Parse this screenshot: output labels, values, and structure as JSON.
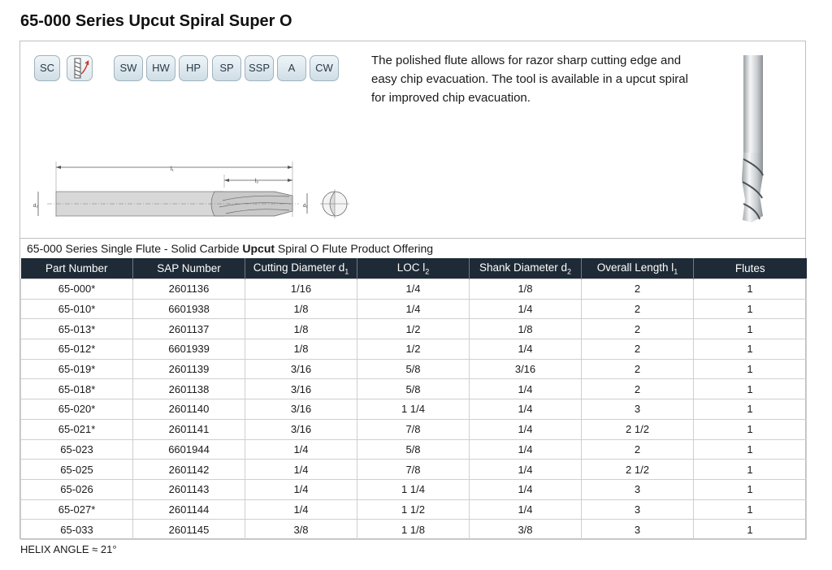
{
  "title": "65-000 Series Upcut Spiral Super O",
  "badges": [
    "SC",
    "SW",
    "HW",
    "HP",
    "SP",
    "SSP",
    "A",
    "CW"
  ],
  "description": "The polished flute allows for razor sharp cutting edge and easy chip evacuation. The tool is available in a upcut spiral for improved chip evacuation.",
  "drawing_labels": {
    "l1": "l₁",
    "l2": "l₂",
    "d1": "d₁",
    "d2": "d₂"
  },
  "offering": {
    "prefix": "65-000 Series Single Flute - Solid Carbide ",
    "bold": "Upcut",
    "suffix": " Spiral O Flute Product Offering"
  },
  "table": {
    "headers": [
      {
        "text": "Part Number",
        "sub": ""
      },
      {
        "text": "SAP Number",
        "sub": ""
      },
      {
        "text": "Cutting Diameter d",
        "sub": "1"
      },
      {
        "text": "LOC l",
        "sub": "2"
      },
      {
        "text": "Shank Diameter d",
        "sub": "2"
      },
      {
        "text": "Overall Length l",
        "sub": "1"
      },
      {
        "text": "Flutes",
        "sub": ""
      }
    ],
    "rows": [
      [
        "65-000*",
        "2601136",
        "1/16",
        "1/4",
        "1/8",
        "2",
        "1"
      ],
      [
        "65-010*",
        "6601938",
        "1/8",
        "1/4",
        "1/4",
        "2",
        "1"
      ],
      [
        "65-013*",
        "2601137",
        "1/8",
        "1/2",
        "1/8",
        "2",
        "1"
      ],
      [
        "65-012*",
        "6601939",
        "1/8",
        "1/2",
        "1/4",
        "2",
        "1"
      ],
      [
        "65-019*",
        "2601139",
        "3/16",
        "5/8",
        "3/16",
        "2",
        "1"
      ],
      [
        "65-018*",
        "2601138",
        "3/16",
        "5/8",
        "1/4",
        "2",
        "1"
      ],
      [
        "65-020*",
        "2601140",
        "3/16",
        "1 1/4",
        "1/4",
        "3",
        "1"
      ],
      [
        "65-021*",
        "2601141",
        "3/16",
        "7/8",
        "1/4",
        "2 1/2",
        "1"
      ],
      [
        "65-023",
        "6601944",
        "1/4",
        "5/8",
        "1/4",
        "2",
        "1"
      ],
      [
        "65-025",
        "2601142",
        "1/4",
        "7/8",
        "1/4",
        "2 1/2",
        "1"
      ],
      [
        "65-026",
        "2601143",
        "1/4",
        "1 1/4",
        "1/4",
        "3",
        "1"
      ],
      [
        "65-027*",
        "2601144",
        "1/4",
        "1 1/2",
        "1/4",
        "3",
        "1"
      ],
      [
        "65-033",
        "2601145",
        "3/8",
        "1 1/8",
        "3/8",
        "3",
        "1"
      ]
    ]
  },
  "footnote": "HELIX ANGLE ≈ 21°",
  "colors": {
    "header_bg": "#1e2b36",
    "border": "#cfcfcf",
    "badge_border": "#9fb3bf"
  }
}
